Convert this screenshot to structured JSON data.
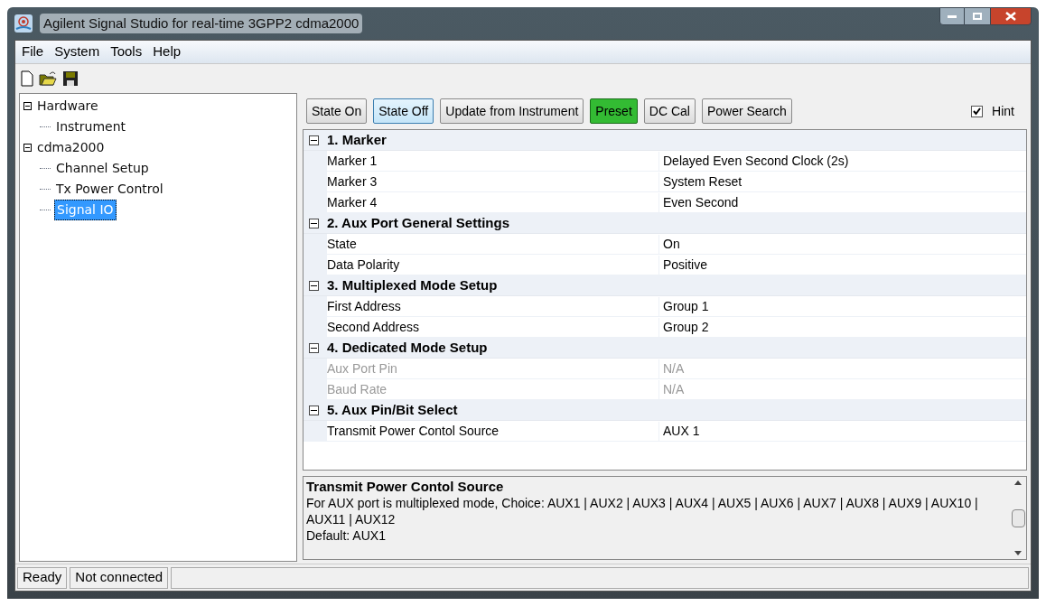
{
  "window": {
    "title": "Agilent Signal Studio for real-time 3GPP2 cdma2000"
  },
  "menu": [
    "File",
    "System",
    "Tools",
    "Help"
  ],
  "tree": [
    {
      "label": "Hardware",
      "expanded": true,
      "selected": false,
      "children": [
        {
          "label": "Instrument",
          "selected": false
        }
      ]
    },
    {
      "label": "cdma2000",
      "expanded": true,
      "selected": false,
      "children": [
        {
          "label": "Channel Setup",
          "selected": false
        },
        {
          "label": "Tx Power Control",
          "selected": false
        },
        {
          "label": "Signal IO",
          "selected": true
        }
      ]
    }
  ],
  "buttons": [
    {
      "label": "State On",
      "kind": "plain"
    },
    {
      "label": "State Off",
      "kind": "hover"
    },
    {
      "label": "Update from Instrument",
      "kind": "plain"
    },
    {
      "label": "Preset",
      "kind": "green"
    },
    {
      "label": "DC Cal",
      "kind": "plain"
    },
    {
      "label": "Power Search",
      "kind": "plain"
    }
  ],
  "hint": {
    "label": "Hint",
    "checked": true
  },
  "grid": [
    {
      "title": "1. Marker",
      "expanded": true,
      "properties": [
        {
          "name": "Marker 1",
          "value": "Delayed Even Second Clock (2s)",
          "disabled": false
        },
        {
          "name": "Marker 3",
          "value": "System Reset",
          "disabled": false
        },
        {
          "name": "Marker 4",
          "value": "Even Second",
          "disabled": false
        }
      ]
    },
    {
      "title": "2. Aux Port General Settings",
      "expanded": true,
      "properties": [
        {
          "name": "State",
          "value": "On",
          "disabled": false
        },
        {
          "name": "Data Polarity",
          "value": "Positive",
          "disabled": false
        }
      ]
    },
    {
      "title": "3. Multiplexed Mode Setup",
      "expanded": true,
      "properties": [
        {
          "name": "First Address",
          "value": "Group 1",
          "disabled": false
        },
        {
          "name": "Second Address",
          "value": "Group 2",
          "disabled": false
        }
      ]
    },
    {
      "title": "4. Dedicated Mode Setup",
      "expanded": true,
      "properties": [
        {
          "name": "Aux Port Pin",
          "value": "N/A",
          "disabled": true
        },
        {
          "name": "Baud Rate",
          "value": "N/A",
          "disabled": true
        }
      ]
    },
    {
      "title": "5. Aux Pin/Bit Select",
      "expanded": true,
      "properties": [
        {
          "name": "Transmit Power Contol Source",
          "value": "AUX 1",
          "disabled": false
        }
      ]
    }
  ],
  "help": {
    "title": "Transmit Power Contol Source",
    "lines": [
      "For AUX port is multiplexed mode, Choice: AUX1 | AUX2 | AUX3 | AUX4 | AUX5 | AUX6 | AUX7 | AUX8 | AUX9 | AUX10 | AUX11 | AUX12",
      "Default: AUX1"
    ]
  },
  "status_bar": [
    "Ready",
    "Not connected"
  ]
}
